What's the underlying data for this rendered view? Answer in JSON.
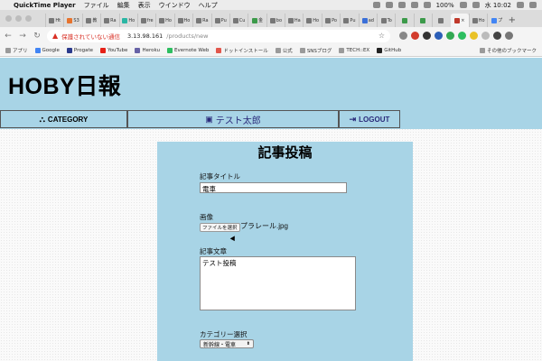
{
  "menubar": {
    "apple": "",
    "items": [
      "QuickTime Player",
      "ファイル",
      "編集",
      "表示",
      "ウインドウ",
      "ヘルプ"
    ],
    "battery": "100%",
    "clock": "水 10:02"
  },
  "tabs": [
    "Ht",
    "S3",
    "教",
    "Ra",
    "Ho",
    "fre",
    "Ho",
    "Ho",
    "Ra",
    "Pu",
    "Cu",
    "金",
    "bo",
    "Ha",
    "Ho",
    "Po",
    "Pu",
    "ad",
    "To",
    "",
    "",
    "",
    "×",
    "Ho",
    "プ"
  ],
  "toolbar": {
    "security_label": "保護されていない通信",
    "url_host": "3.13.98.161",
    "url_path": "/products/new"
  },
  "bookmarks": [
    "アプリ",
    "Google",
    "Progate",
    "YouTube",
    "Heroku",
    "Evernote Web",
    "ドットインストール",
    "公式",
    "SNSブログ",
    "TECH::EX",
    "GitHub",
    "その他のブックマーク"
  ],
  "site": {
    "logo": "HOBY日報",
    "nav": {
      "category": "CATEGORY",
      "user": "テスト太郎",
      "logout": "LOGOUT"
    }
  },
  "form": {
    "heading": "記事投稿",
    "title_label": "記事タイトル",
    "title_value": "電車",
    "image_label": "画像",
    "file_button": "ファイルを選択",
    "file_name": "プラレール.jpg",
    "body_label": "記事文章",
    "body_value": "テスト投稿",
    "category_label": "カテゴリー選択",
    "category_value": "新幹線・電車"
  }
}
